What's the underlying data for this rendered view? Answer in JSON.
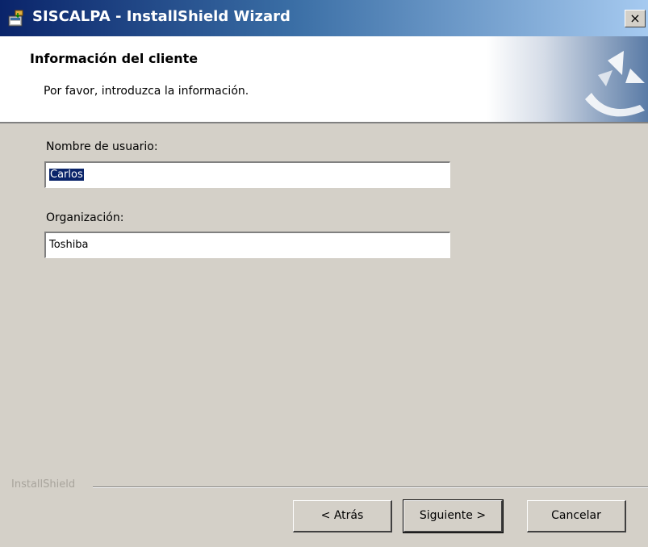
{
  "window": {
    "title": "SISCALPA - InstallShield Wizard",
    "close_glyph": "×"
  },
  "header": {
    "title": "Información del cliente",
    "subtitle": "Por favor, introduzca la información."
  },
  "form": {
    "username_label": "Nombre de usuario:",
    "username_value": "Carlos",
    "organization_label": "Organización:",
    "organization_value": "Toshiba"
  },
  "footer": {
    "brand": "InstallShield",
    "back_label": "< Atrás",
    "next_label": "Siguiente >",
    "cancel_label": "Cancelar"
  },
  "icons": {
    "title_icon": "installer-icon",
    "banner_graphic": "installshield-logo-icon"
  },
  "colors": {
    "title_bar_start": "#0a246a",
    "title_bar_end": "#a6caf0",
    "dialog_background": "#d4d0c8",
    "selection": "#0a246a"
  }
}
